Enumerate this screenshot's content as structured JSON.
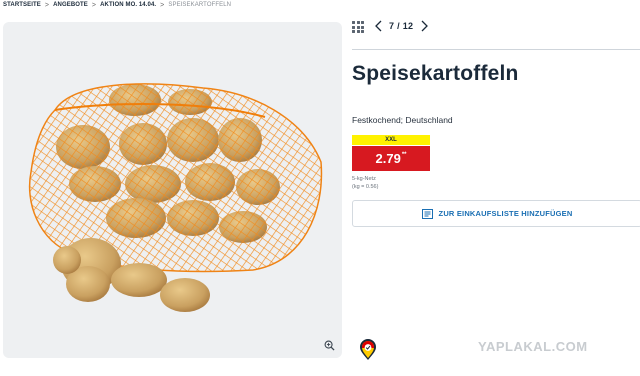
{
  "breadcrumb": {
    "items": [
      "STARTSEITE",
      "ANGEBOTE",
      "AKTION MO. 14.04."
    ],
    "current": "SPEISEKARTOFFELN",
    "separator": ">"
  },
  "gallery": {
    "image_alt": "Speisekartoffeln im Netz",
    "zoom_icon": "magnifier-plus-icon"
  },
  "pager": {
    "counter": "7 / 12",
    "grid_icon": "grid-icon",
    "prev_icon": "chevron-left-icon",
    "next_icon": "chevron-right-icon"
  },
  "product": {
    "title": "Speisekartoffeln",
    "subtitle": "Festkochend; Deutschland",
    "badge": "XXL",
    "price": "2.79",
    "price_suffix": "**",
    "unit_line1": "5-kg-Netz",
    "unit_line2": "(kg = 0.56)"
  },
  "actions": {
    "add_to_list": "ZUR EINKAUFSLISTE HINZUFÜGEN",
    "list_icon": "shopping-list-icon"
  },
  "origin_badge": "germany-origin-icon",
  "watermark": "YAPLAKAL.COM",
  "colors": {
    "price_red": "#d71920",
    "badge_yellow": "#fff200",
    "link_blue": "#1a6fb3",
    "text_navy": "#1b2a3a"
  }
}
